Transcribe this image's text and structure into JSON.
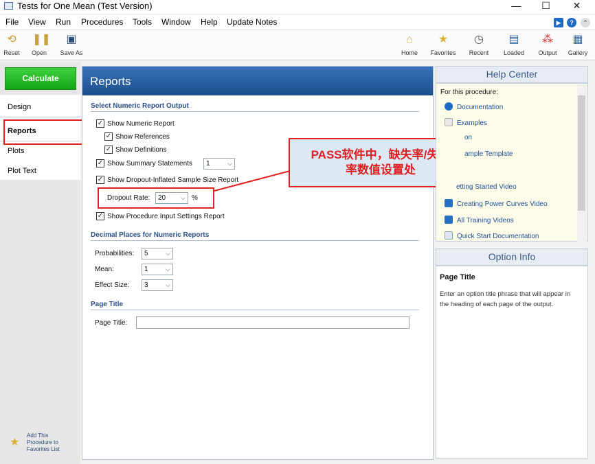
{
  "window": {
    "title": "Tests for One Mean (Test Version)",
    "minimize": "—",
    "maximize": "☐",
    "close": "✕"
  },
  "menu": [
    "File",
    "View",
    "Run",
    "Procedures",
    "Tools",
    "Window",
    "Help",
    "Update Notes"
  ],
  "toolbar": {
    "left": [
      {
        "label": "Reset",
        "icon": "reset-icon"
      },
      {
        "label": "Open",
        "icon": "open-icon"
      },
      {
        "label": "Save As",
        "icon": "save-icon"
      }
    ],
    "right": [
      {
        "label": "Home",
        "icon": "home-icon"
      },
      {
        "label": "Favorites",
        "icon": "star-icon"
      },
      {
        "label": "Recent",
        "icon": "clock-icon"
      },
      {
        "label": "Loaded",
        "icon": "window-icon"
      },
      {
        "label": "Output",
        "icon": "output-icon"
      },
      {
        "label": "Gallery",
        "icon": "gallery-icon"
      }
    ]
  },
  "leftpanel": {
    "calculate": "Calculate",
    "tabs": [
      "Design",
      "Reports",
      "Plots",
      "Plot Text"
    ],
    "favorites_line1": "Add This",
    "favorites_line2": "Procedure to",
    "favorites_line3": "Favorites List"
  },
  "main": {
    "header": "Reports",
    "section1": "Select Numeric Report Output",
    "show_numeric_report": "Show Numeric Report",
    "show_references": "Show References",
    "show_definitions": "Show Definitions",
    "show_summary": "Show Summary Statements",
    "summary_value": "1",
    "show_dropout": "Show Dropout-Inflated Sample Size Report",
    "dropout_label": "Dropout Rate:",
    "dropout_value": "20",
    "dropout_unit": "%",
    "show_input_settings": "Show Procedure Input Settings Report",
    "section2": "Decimal Places for Numeric Reports",
    "prob_label": "Probabilities:",
    "prob_value": "5",
    "mean_label": "Mean:",
    "mean_value": "1",
    "effect_label": "Effect Size:",
    "effect_value": "3",
    "section3": "Page Title",
    "page_title_label": "Page Title:",
    "page_title_value": ""
  },
  "annotation": {
    "line1": "PASS软件中，缺失率/失访",
    "line2": "率数值设置处"
  },
  "help": {
    "header": "Help Center",
    "for_this": "For this procedure:",
    "links": [
      "Documentation",
      "Examples",
      "on",
      "ample Template",
      "etting Started Video",
      "Creating Power Curves Video",
      "All Training Videos",
      "Quick Start Documentation"
    ]
  },
  "option_info": {
    "header": "Option Info",
    "title": "Page Title",
    "text_line1": "Enter an option title phrase that will appear in",
    "text_line2": "the heading of each page of the output."
  }
}
